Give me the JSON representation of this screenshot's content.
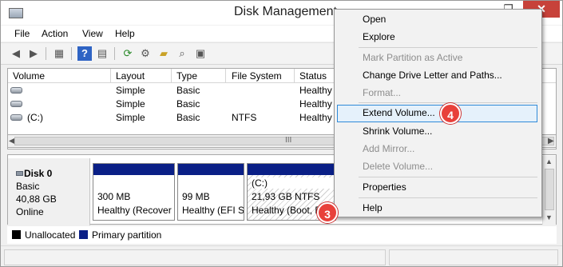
{
  "window": {
    "title": "Disk Management",
    "min": "—",
    "max": "❐",
    "close": "✕"
  },
  "menubar": {
    "file": "File",
    "action": "Action",
    "view": "View",
    "help": "Help"
  },
  "toolbar": {
    "back_icon": "◀",
    "forward_icon": "▶",
    "props_icon": "▦",
    "help_icon": "?",
    "list_icon": "▤",
    "refresh_icon": "⟳",
    "rescan_icon": "⚙",
    "open_icon": "▰",
    "search_icon": "⌕",
    "props2_icon": "▣"
  },
  "volume_table": {
    "headers": [
      "Volume",
      "Layout",
      "Type",
      "File System",
      "Status"
    ],
    "rows": [
      {
        "volume": "",
        "layout": "Simple",
        "type": "Basic",
        "fs": "",
        "status": "Healthy"
      },
      {
        "volume": "",
        "layout": "Simple",
        "type": "Basic",
        "fs": "",
        "status": "Healthy"
      },
      {
        "volume": "(C:)",
        "layout": "Simple",
        "type": "Basic",
        "fs": "NTFS",
        "status": "Healthy"
      }
    ],
    "scroll_left": "◀",
    "scroll_right": "▶",
    "grip": "III"
  },
  "disk": {
    "name": "Disk 0",
    "type": "Basic",
    "size": "40,88 GB",
    "state": "Online",
    "partitions": [
      {
        "size": "300 MB",
        "status": "Healthy (Recover"
      },
      {
        "size": "99 MB",
        "status": "Healthy (EFI S"
      },
      {
        "label": "(C:)",
        "size": "21,93 GB NTFS",
        "status": "Healthy (Boot, P"
      }
    ]
  },
  "vscroll": {
    "up": "▲",
    "down": "▼"
  },
  "legend": {
    "unallocated": "Unallocated",
    "primary": "Primary partition",
    "unallocated_color": "#000000",
    "primary_color": "#0a1f86"
  },
  "context_menu": {
    "items": [
      {
        "label": "Open",
        "enabled": true
      },
      {
        "label": "Explore",
        "enabled": true
      },
      {
        "label": "Mark Partition as Active",
        "enabled": false
      },
      {
        "label": "Change Drive Letter and Paths...",
        "enabled": true
      },
      {
        "label": "Format...",
        "enabled": false
      },
      {
        "label": "Extend Volume...",
        "enabled": true,
        "highlighted": true
      },
      {
        "label": "Shrink Volume...",
        "enabled": true
      },
      {
        "label": "Add Mirror...",
        "enabled": false
      },
      {
        "label": "Delete Volume...",
        "enabled": false
      },
      {
        "label": "Properties",
        "enabled": true
      },
      {
        "label": "Help",
        "enabled": true
      }
    ]
  },
  "badges": {
    "step3": "3",
    "step4": "4",
    "color": "#e8403a"
  }
}
